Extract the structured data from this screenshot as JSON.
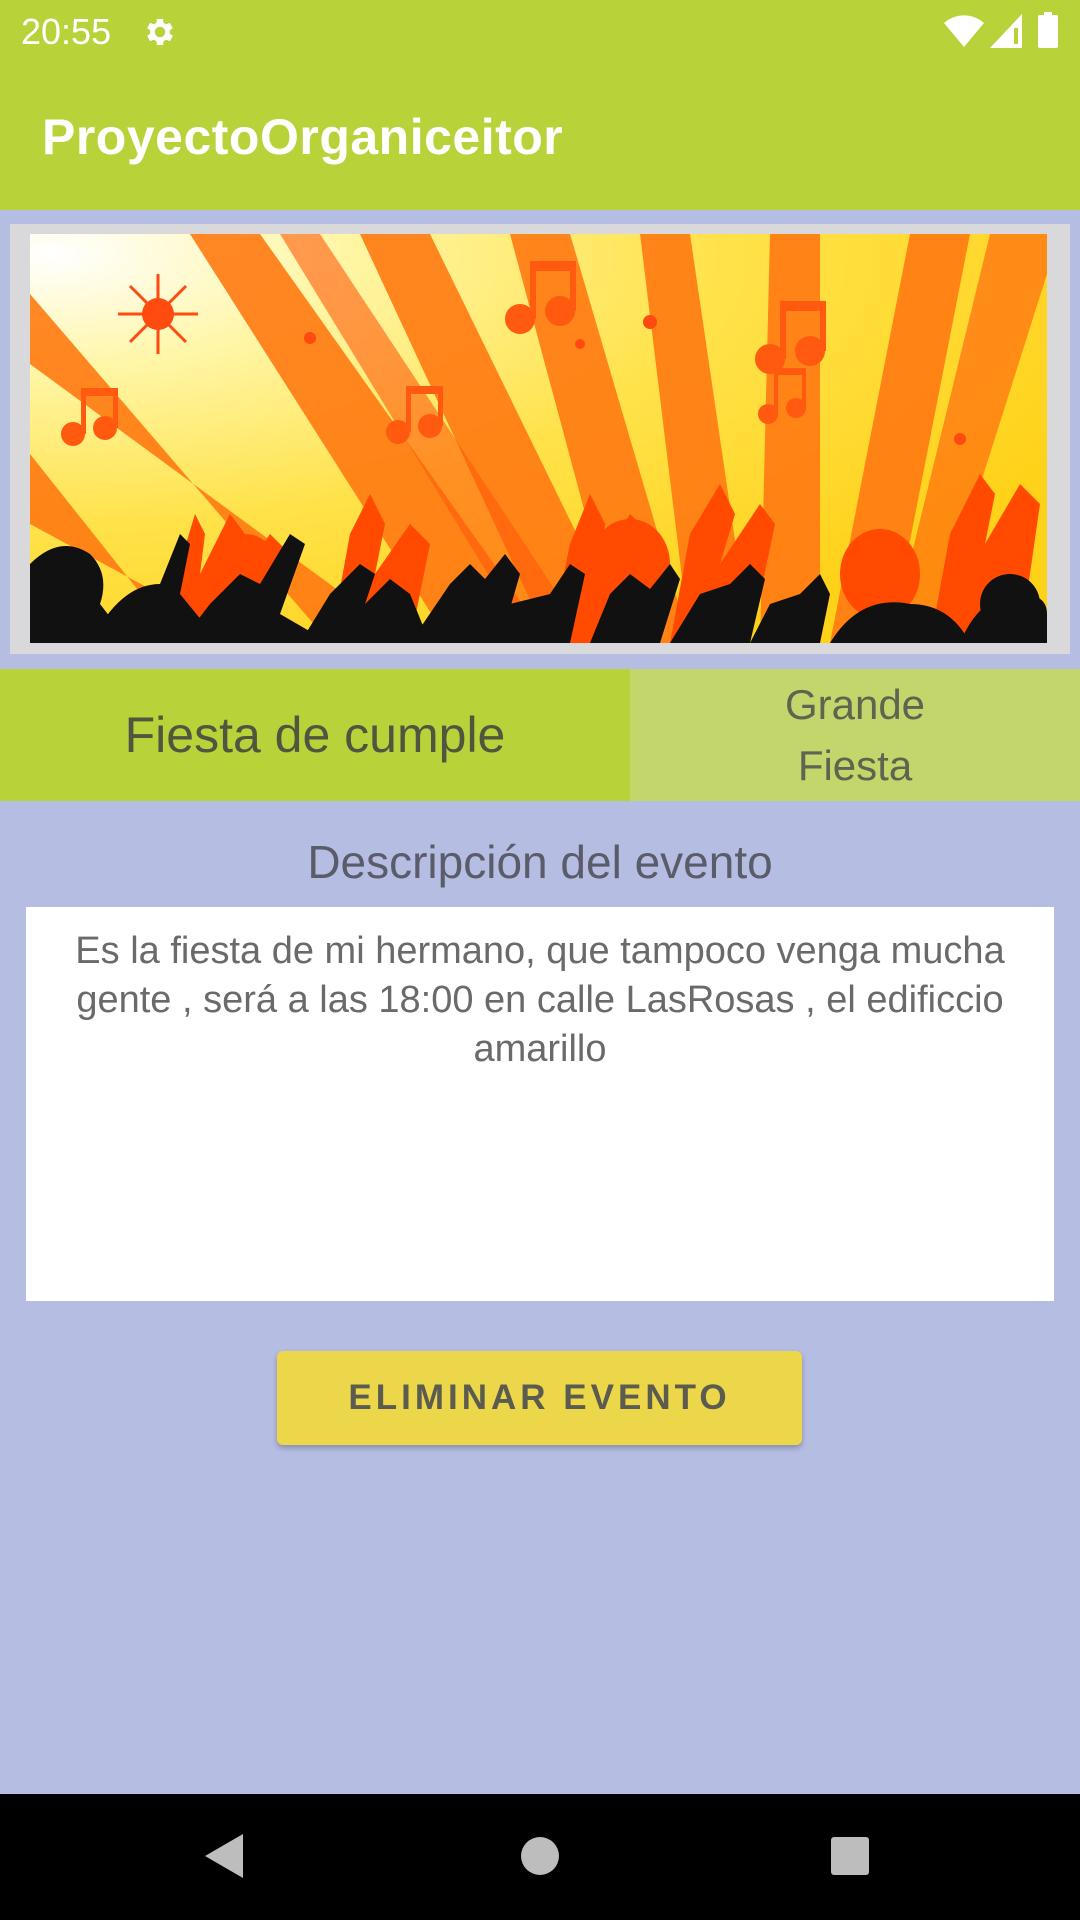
{
  "status_bar": {
    "time": "20:55",
    "icons": [
      "gear-icon",
      "wifi-icon",
      "signal-icon",
      "battery-icon"
    ]
  },
  "app_bar": {
    "title": "ProyectoOrganiceitor"
  },
  "event": {
    "banner": "party-banner-image",
    "title": "Fiesta de cumple",
    "type": "Grande Fiesta",
    "description_heading": "Descripción del evento",
    "description": "Es la fiesta de mi hermano, que tampoco venga mucha gente , será a las 18:00 en calle LasRosas , el edificcio amarillo"
  },
  "actions": {
    "delete_label": "ELIMINAR EVENTO"
  },
  "nav_bar": {
    "icons": [
      "back-icon",
      "home-icon",
      "recents-icon"
    ]
  },
  "colors": {
    "app_bar": "#b8d23a",
    "background": "#b6bde3",
    "type_cell": "#c2d66c",
    "button": "#ecd74a"
  }
}
